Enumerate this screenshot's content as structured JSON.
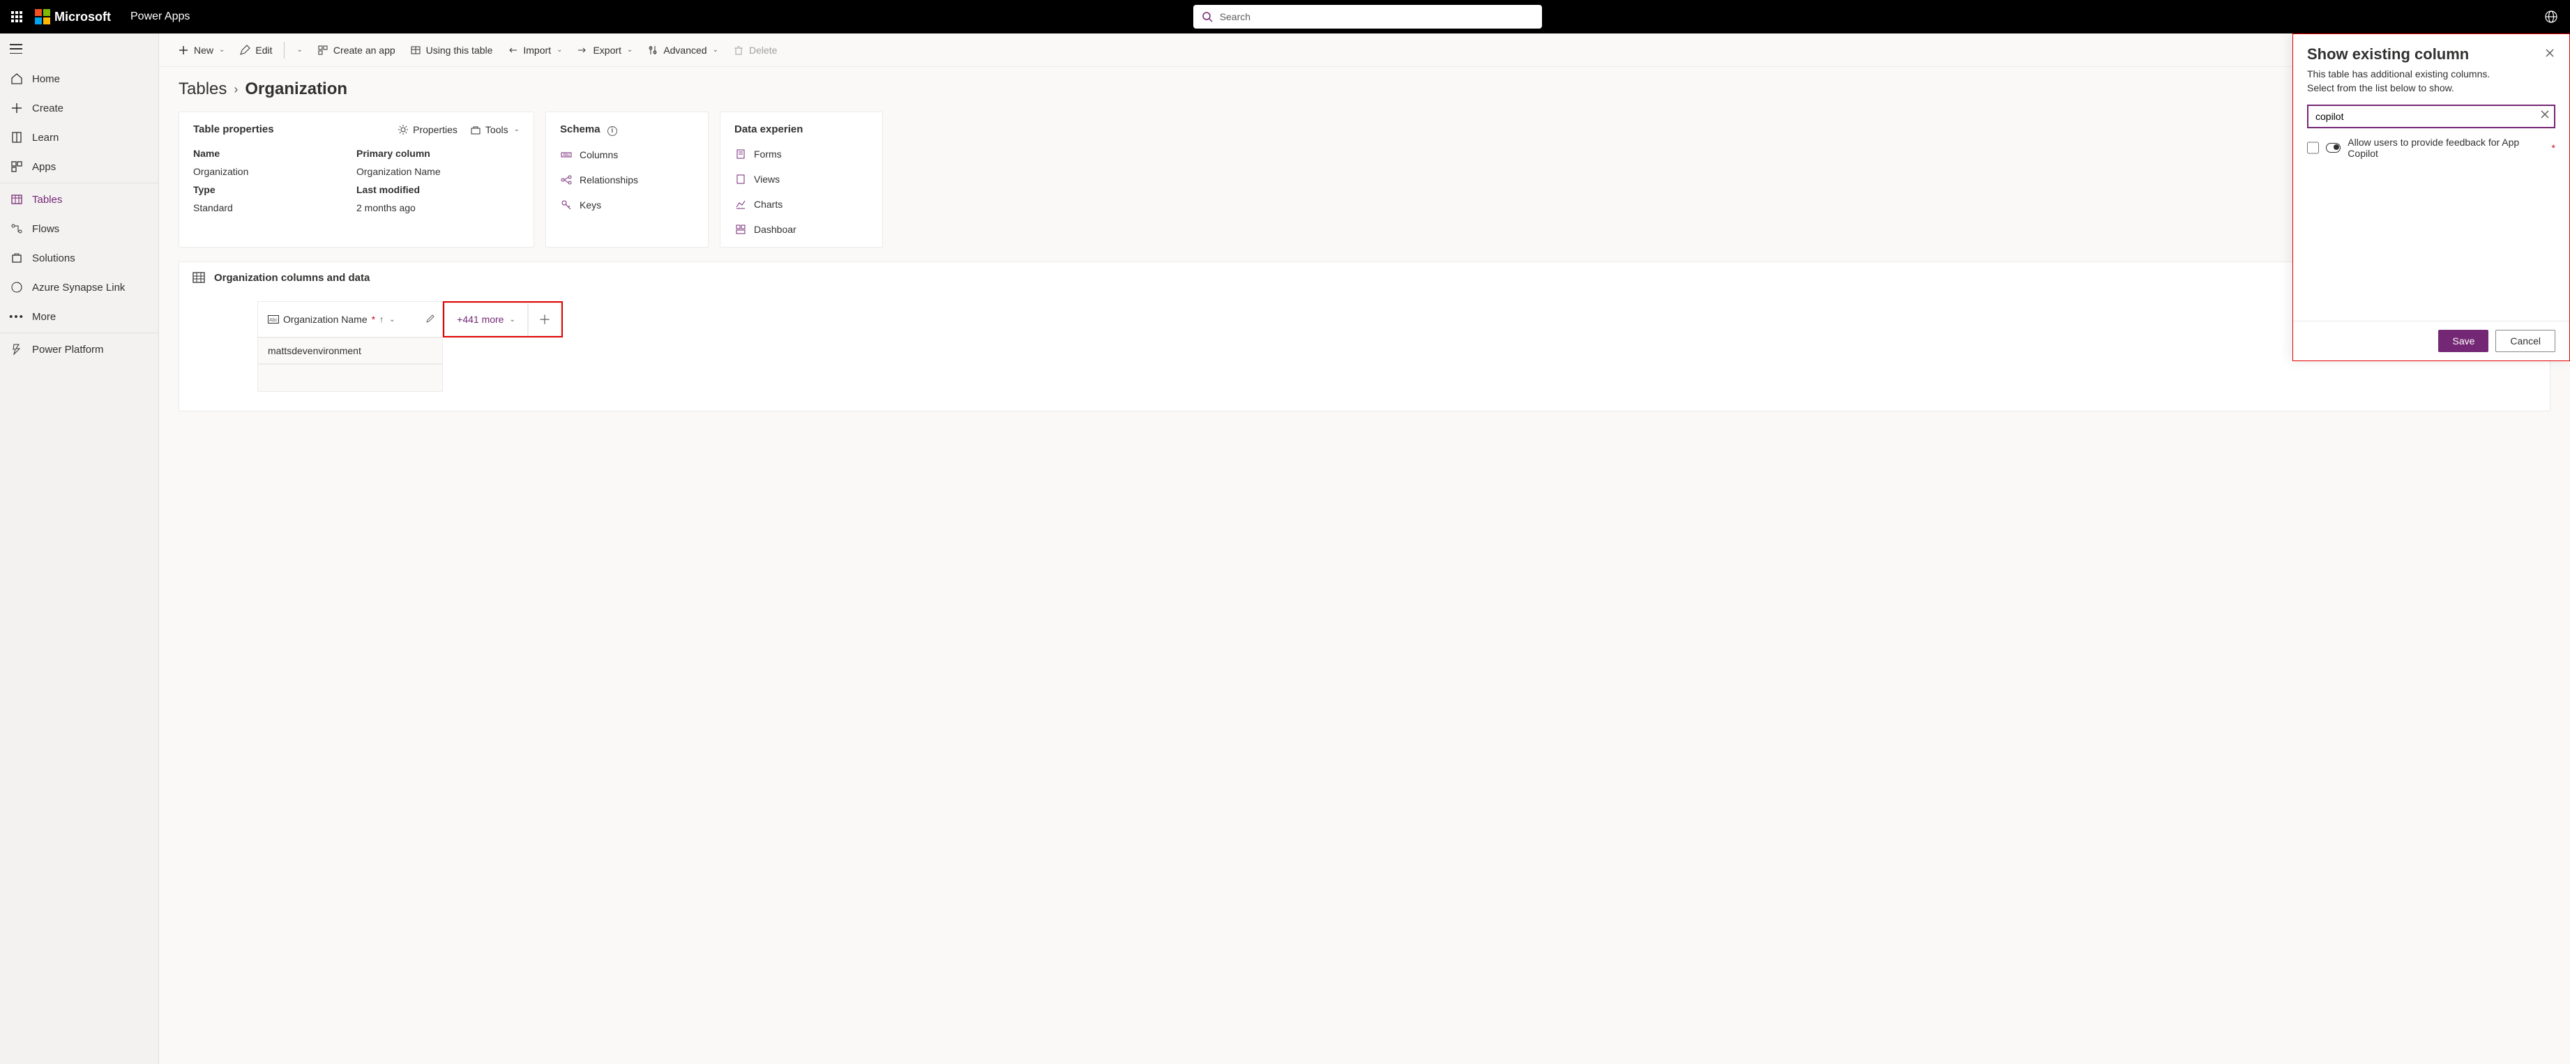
{
  "header": {
    "ms": "Microsoft",
    "app": "Power Apps",
    "search_placeholder": "Search"
  },
  "nav": {
    "items": [
      {
        "label": "Home"
      },
      {
        "label": "Create"
      },
      {
        "label": "Learn"
      },
      {
        "label": "Apps"
      },
      {
        "label": "Tables"
      },
      {
        "label": "Flows"
      },
      {
        "label": "Solutions"
      },
      {
        "label": "Azure Synapse Link"
      },
      {
        "label": "More"
      },
      {
        "label": "Power Platform"
      }
    ]
  },
  "cmdbar": {
    "new": "New",
    "edit": "Edit",
    "createapp": "Create an app",
    "using": "Using this table",
    "import": "Import",
    "export": "Export",
    "advanced": "Advanced",
    "delete": "Delete"
  },
  "breadcrumb": {
    "root": "Tables",
    "current": "Organization"
  },
  "props_card": {
    "title": "Table properties",
    "properties_action": "Properties",
    "tools_action": "Tools",
    "name_label": "Name",
    "name_value": "Organization",
    "primary_label": "Primary column",
    "primary_value": "Organization Name",
    "type_label": "Type",
    "type_value": "Standard",
    "modified_label": "Last modified",
    "modified_value": "2 months ago"
  },
  "schema_card": {
    "title": "Schema",
    "columns": "Columns",
    "relationships": "Relationships",
    "keys": "Keys"
  },
  "de_card": {
    "title": "Data experien",
    "forms": "Forms",
    "views": "Views",
    "charts": "Charts",
    "dashboards": "Dashboar"
  },
  "colsdata": {
    "title": "Organization columns and data",
    "colname": "Organization Name",
    "more": "+441 more",
    "row0": "mattsdevenvironment"
  },
  "panel": {
    "title": "Show existing column",
    "sub1": "This table has additional existing columns.",
    "sub2": "Select from the list below to show.",
    "search_value": "copilot",
    "result": "Allow users to provide feedback for App Copilot",
    "save": "Save",
    "cancel": "Cancel"
  }
}
